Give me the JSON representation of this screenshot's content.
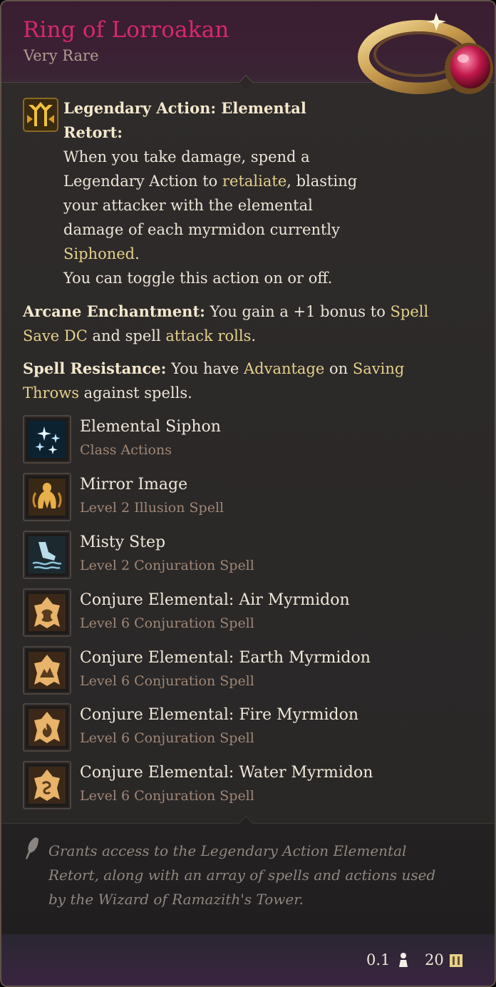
{
  "item": {
    "name": "Ring of Lorroakan",
    "rarity": "Very Rare"
  },
  "legendary_action": {
    "title": "Legendary Action: Elemental Retort:",
    "text_1": "When you take damage, spend a Legendary Action to ",
    "link_retaliate": "retaliate",
    "text_2": ", blasting your attacker with the elemental damage of each myrmidon currently ",
    "link_siphoned": "Siphoned",
    "text_3": ".",
    "toggle_note": "You can toggle this action on or off."
  },
  "arcane_enchantment": {
    "title": "Arcane Enchantment:",
    "text_1": " You gain a +1 bonus to ",
    "link_spell_save": "Spell Save DC",
    "text_2": " and spell ",
    "link_attack_rolls": "attack rolls",
    "text_3": "."
  },
  "spell_resistance": {
    "title": "Spell Resistance:",
    "text_1": " You have ",
    "link_advantage": "Advantage",
    "text_2": " on ",
    "link_saving_throws": "Saving Throws",
    "text_3": " against spells."
  },
  "spells": [
    {
      "name": "Elemental Siphon",
      "sub": "Class Actions",
      "icon": "sparkles-icon"
    },
    {
      "name": "Mirror Image",
      "sub": "Level 2 Illusion Spell",
      "icon": "mirror-image-icon"
    },
    {
      "name": "Misty Step",
      "sub": "Level 2 Conjuration Spell",
      "icon": "misty-step-icon"
    },
    {
      "name": "Conjure Elemental: Air Myrmidon",
      "sub": "Level 6 Conjuration Spell",
      "icon": "air-myrmidon-icon"
    },
    {
      "name": "Conjure Elemental: Earth Myrmidon",
      "sub": "Level 6 Conjuration Spell",
      "icon": "earth-myrmidon-icon"
    },
    {
      "name": "Conjure Elemental: Fire Myrmidon",
      "sub": "Level 6 Conjuration Spell",
      "icon": "fire-myrmidon-icon"
    },
    {
      "name": "Conjure Elemental: Water Myrmidon",
      "sub": "Level 6 Conjuration Spell",
      "icon": "water-myrmidon-icon"
    }
  ],
  "flavor": {
    "text": "Grants access to the Legendary Action Elemental Retort, along with an array of spells and actions used by the Wizard of Ramazith's Tower."
  },
  "footer": {
    "weight": "0.1",
    "value": "20"
  },
  "colors": {
    "rarity_name": "#d7286e",
    "highlight": "#e4d08a",
    "subtitle": "#9f8776"
  }
}
